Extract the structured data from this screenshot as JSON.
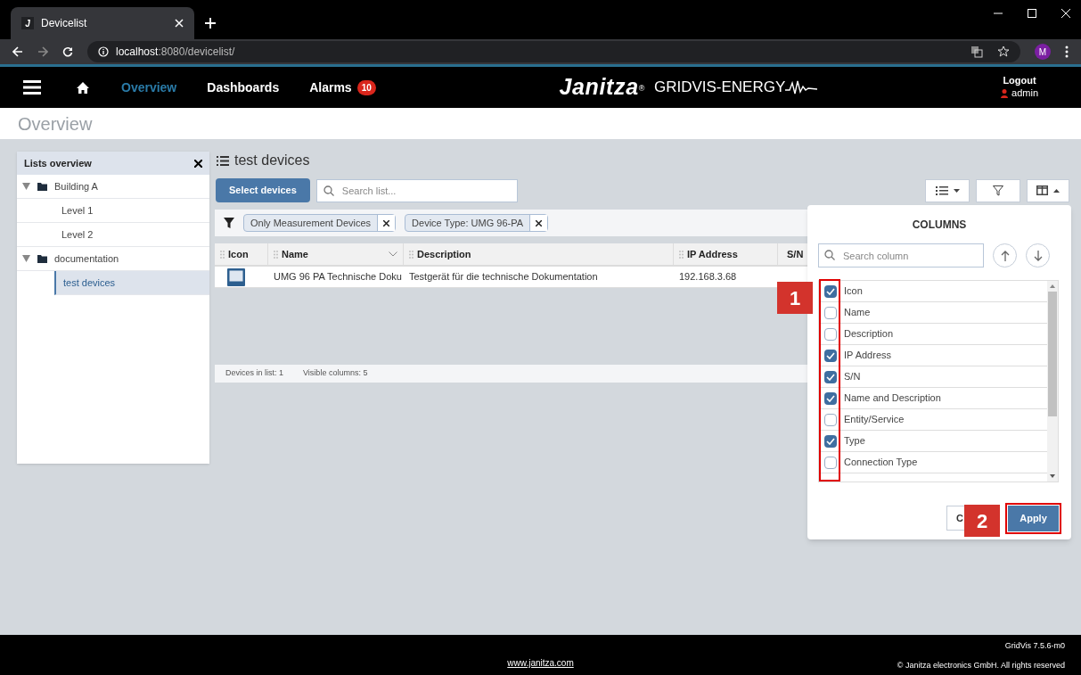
{
  "browser": {
    "tab_icon_letter": "J",
    "tab_title": "Devicelist",
    "url_host": "localhost",
    "url_path": ":8080/devicelist/",
    "profile_initial": "M"
  },
  "nav": {
    "items": [
      {
        "label": "Overview",
        "selected": true
      },
      {
        "label": "Dashboards",
        "selected": false
      },
      {
        "label": "Alarms",
        "selected": false,
        "badge": "10"
      }
    ],
    "brand": "Janitza",
    "brand_mark": "®",
    "product": "GRIDVIS-ENERGY",
    "logout": "Logout",
    "user": "admin"
  },
  "page_title": "Overview",
  "lists_panel": {
    "title": "Lists overview",
    "tree": [
      {
        "label": "Building A",
        "expanded": true,
        "children": [
          {
            "label": "Level 1",
            "selected": false
          },
          {
            "label": "Level 2",
            "selected": false
          }
        ]
      },
      {
        "label": "documentation",
        "expanded": true,
        "children": [
          {
            "label": "test devices",
            "selected": true
          }
        ]
      }
    ]
  },
  "list": {
    "title": "test devices",
    "select_button": "Select devices",
    "search_placeholder": "Search list...",
    "filters": [
      "Only Measurement Devices",
      "Device Type: UMG 96-PA"
    ],
    "columns": [
      "Icon",
      "Name",
      "Description",
      "IP Address",
      "S/N"
    ],
    "rows": [
      {
        "name": "UMG 96 PA Technische Doku",
        "description": "Testgerät für die technische Dokumentation",
        "ip_address": "192.168.3.68"
      }
    ],
    "status": [
      {
        "label": "Devices in list:",
        "value": "1"
      },
      {
        "label": "Visible columns:",
        "value": "5"
      }
    ]
  },
  "columns_popover": {
    "title": "COLUMNS",
    "search_placeholder": "Search column",
    "items": [
      {
        "label": "Icon",
        "checked": true
      },
      {
        "label": "Name",
        "checked": false
      },
      {
        "label": "Description",
        "checked": false
      },
      {
        "label": "IP Address",
        "checked": true
      },
      {
        "label": "S/N",
        "checked": true
      },
      {
        "label": "Name and Description",
        "checked": true
      },
      {
        "label": "Entity/Service",
        "checked": false
      },
      {
        "label": "Type",
        "checked": true
      },
      {
        "label": "Connection Type",
        "checked": false
      }
    ],
    "cancel": "C",
    "apply": "Apply"
  },
  "callouts": [
    "1",
    "2"
  ],
  "footer": {
    "link": "www.janitza.com",
    "version": "GridVis 7.5.6-m0",
    "copyright": "© Janitza electronics GmbH. All rights reserved"
  }
}
